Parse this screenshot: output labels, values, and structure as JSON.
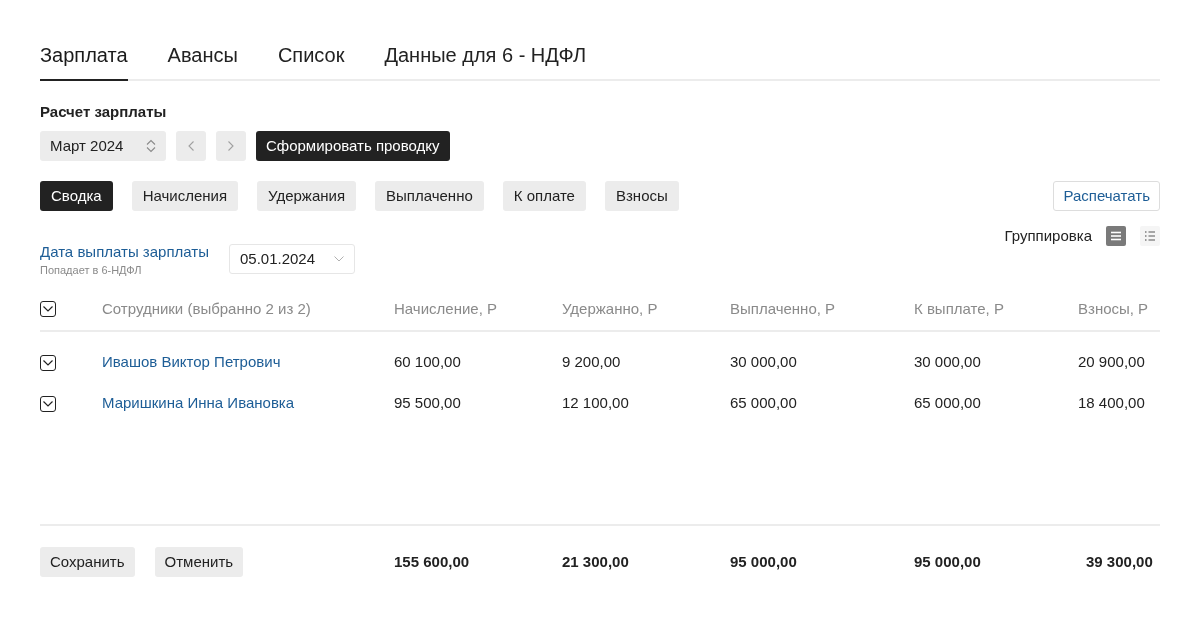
{
  "tabs": [
    {
      "label": "Зарплата",
      "selected": true
    },
    {
      "label": "Авансы",
      "selected": false
    },
    {
      "label": "Список",
      "selected": false
    },
    {
      "label": "Данные для 6 - НДФЛ",
      "selected": false
    }
  ],
  "section_title": "Расчет зарплаты",
  "period": {
    "value": "Март 2024"
  },
  "generate_button": "Сформировать проводку",
  "sub_tabs": [
    {
      "label": "Сводка",
      "selected": true
    },
    {
      "label": "Начисления",
      "selected": false
    },
    {
      "label": "Удержания",
      "selected": false
    },
    {
      "label": "Выплаченно",
      "selected": false
    },
    {
      "label": "К оплате",
      "selected": false
    },
    {
      "label": "Взносы",
      "selected": false
    }
  ],
  "print_button": "Распечатать",
  "payment_date": {
    "label": "Дата выплаты зарплаты",
    "hint": "Попадает в 6-НДФЛ",
    "value": "05.01.2024"
  },
  "grouping": {
    "label": "Группировка",
    "view_modes": [
      {
        "kind": "table",
        "selected": true
      },
      {
        "kind": "list",
        "selected": false
      }
    ]
  },
  "table": {
    "select_all_checked": true,
    "columns": [
      "Сотрудники (выбранно 2 из 2)",
      "Начисление, Р",
      "Удержанно, Р",
      "Выплаченно, Р",
      "К выплате, Р",
      "Взносы, Р"
    ],
    "rows": [
      {
        "checked": true,
        "cells": [
          "Ивашов Виктор Петрович",
          "60 100,00",
          "9 200,00",
          "30 000,00",
          "30 000,00",
          "20 900,00"
        ]
      },
      {
        "checked": true,
        "cells": [
          "Маришкина Инна Ивановка",
          "95 500,00",
          "12 100,00",
          "65 000,00",
          "65 000,00",
          "18 400,00"
        ]
      }
    ]
  },
  "footer": {
    "buttons": [
      "Сохранить",
      "Отменить"
    ],
    "totals": [
      "155 600,00",
      "21 300,00",
      "95 000,00",
      "95 000,00",
      "39 300,00"
    ]
  }
}
